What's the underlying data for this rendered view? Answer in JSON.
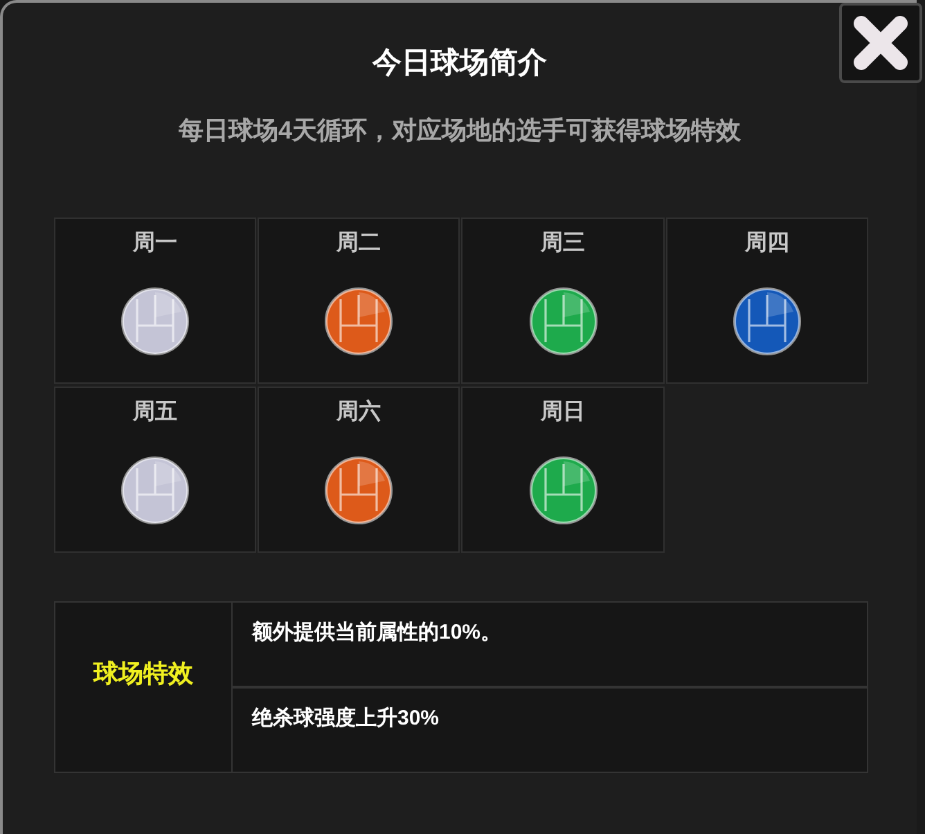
{
  "dialog": {
    "title": "今日球场简介",
    "subtitle": "每日球场4天循环，对应场地的选手可获得球场特效"
  },
  "days": [
    {
      "label": "周一",
      "color": "#c4c4d6"
    },
    {
      "label": "周二",
      "color": "#dd5a1a"
    },
    {
      "label": "周三",
      "color": "#1eaa4c"
    },
    {
      "label": "周四",
      "color": "#1458b8"
    },
    {
      "label": "周五",
      "color": "#c4c4d6"
    },
    {
      "label": "周六",
      "color": "#dd5a1a"
    },
    {
      "label": "周日",
      "color": "#1eaa4c"
    }
  ],
  "effects": {
    "label": "球场特效",
    "items": [
      "额外提供当前属性的10%。",
      "绝杀球强度上升30%"
    ]
  }
}
